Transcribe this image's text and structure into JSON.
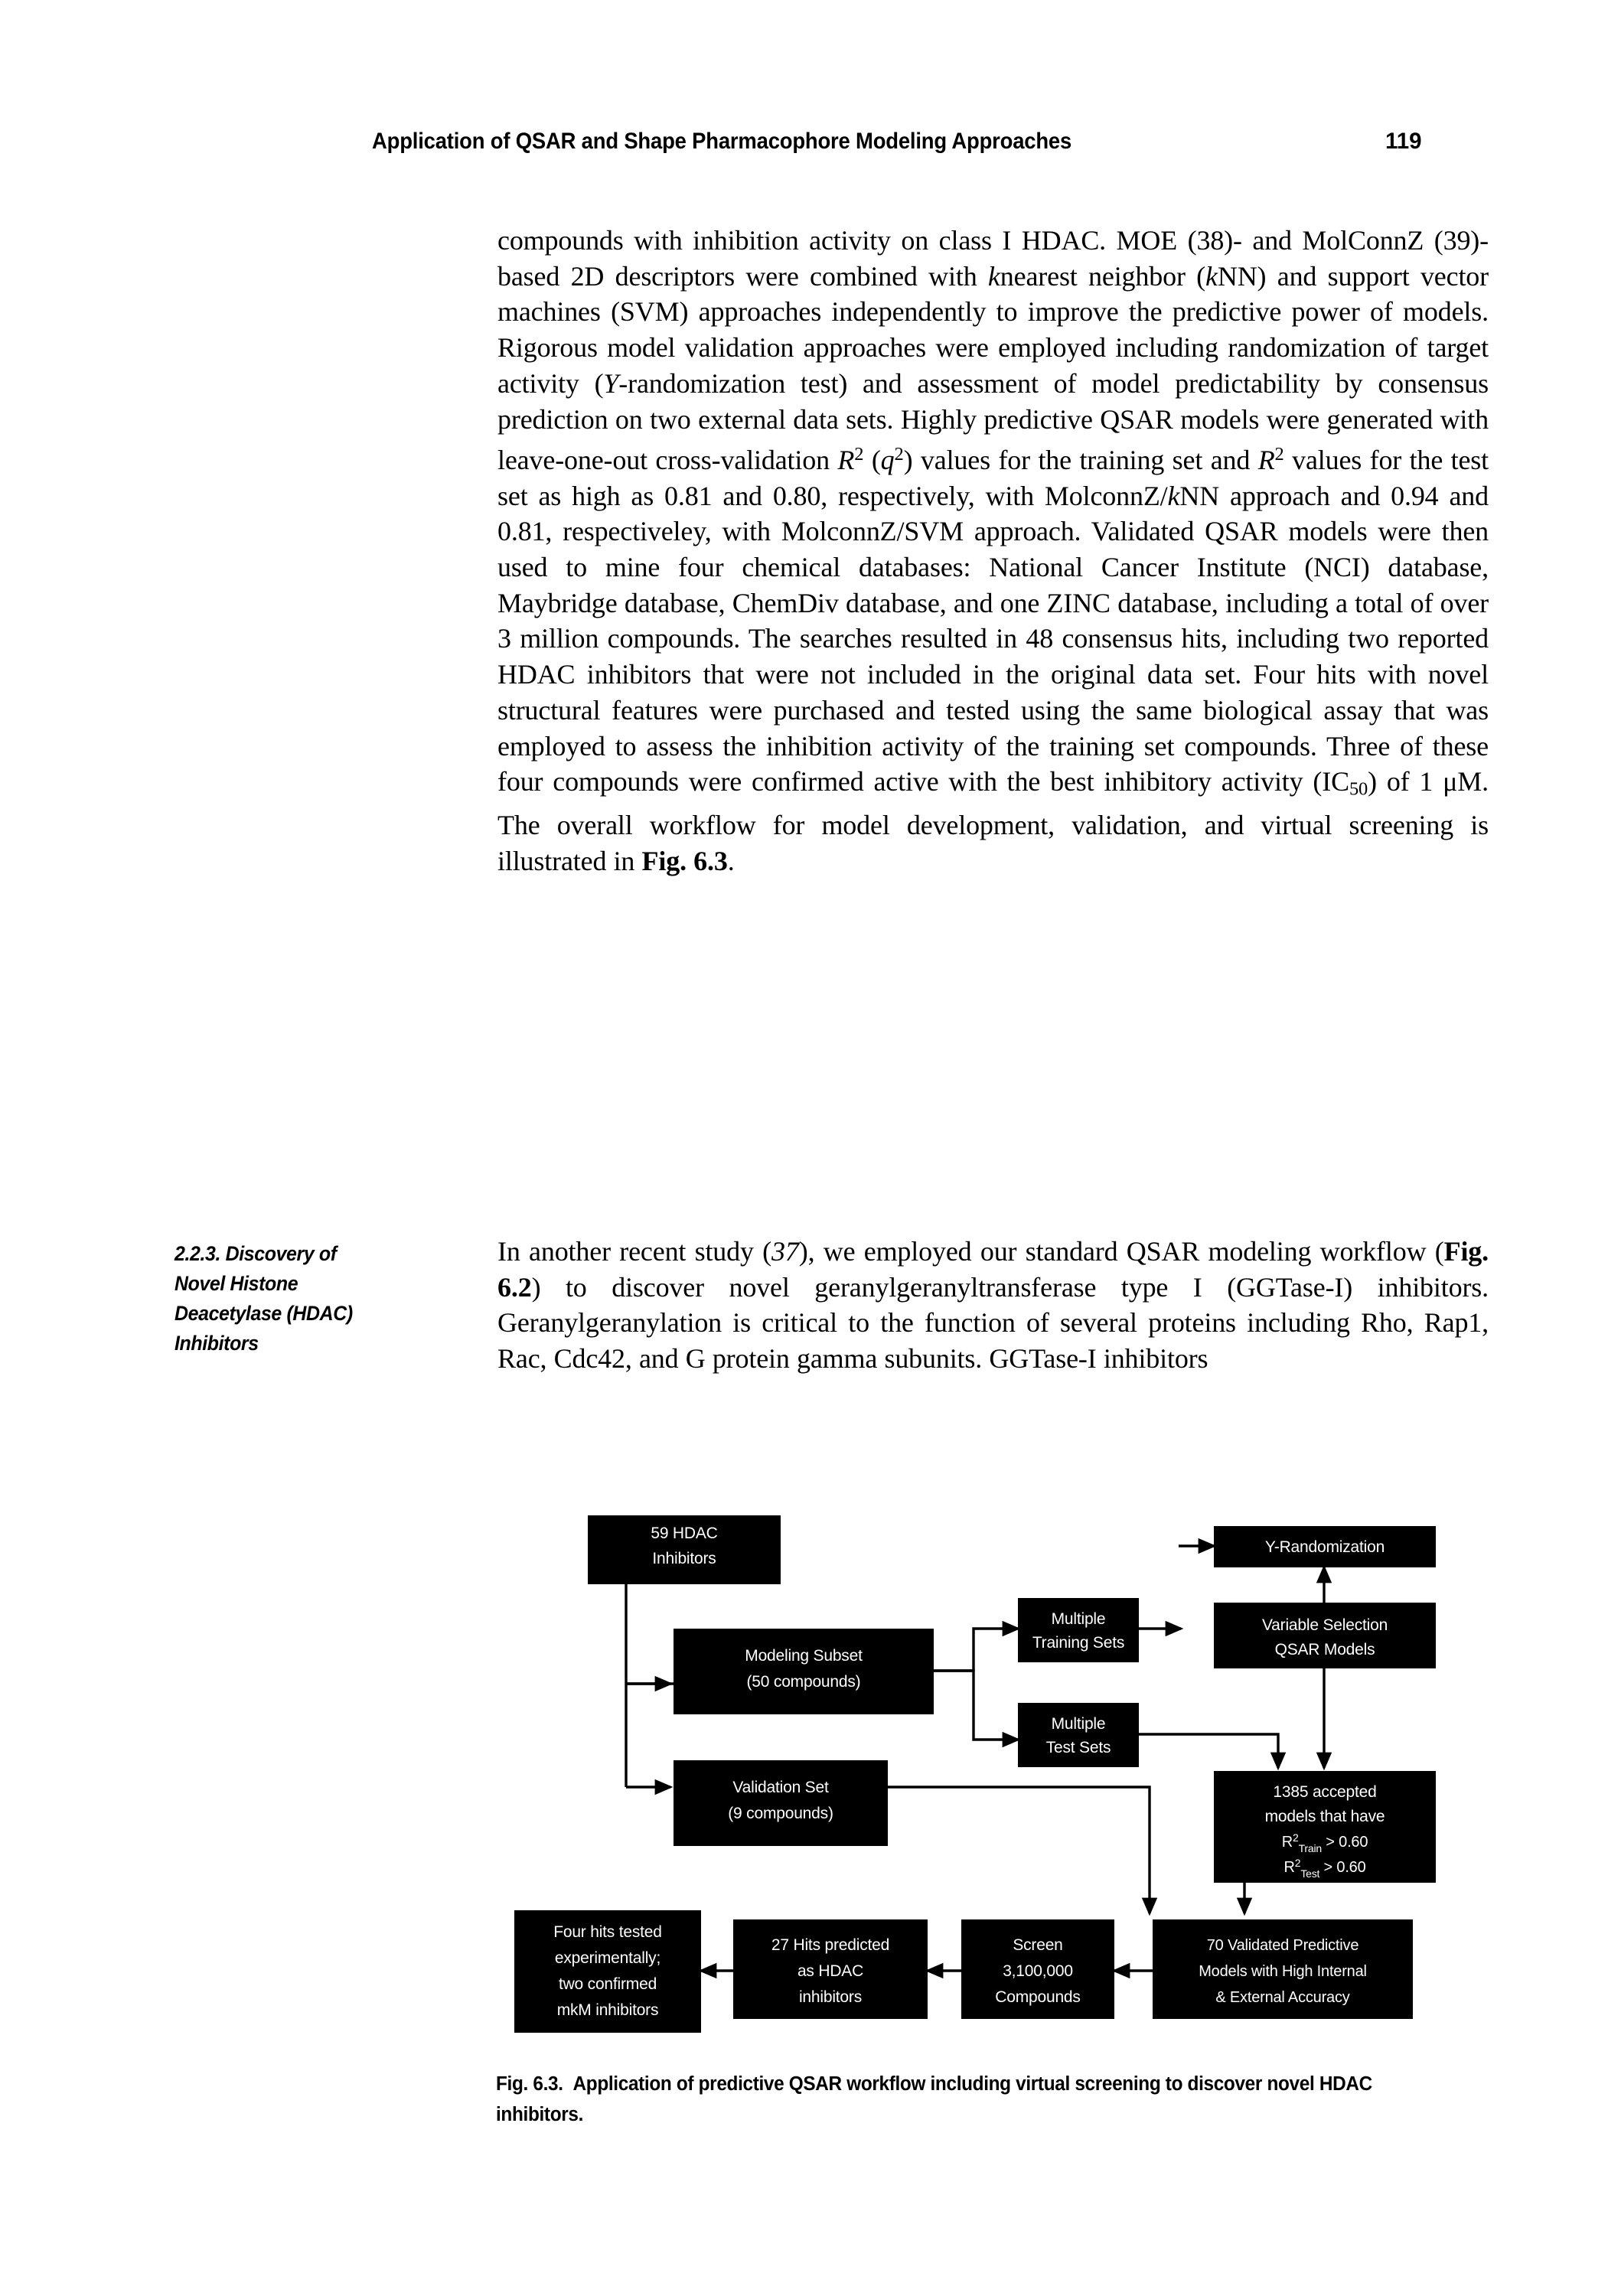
{
  "running_head": {
    "title": "Application of QSAR and Shape Pharmacophore Modeling Approaches",
    "page_number": "119"
  },
  "body": {
    "paragraph_1_parts": {
      "p1": "compounds with inhibition activity on class I HDAC. MOE (38)- and MolConnZ (39)-based 2D descriptors were combined with ",
      "k1": "k",
      "p2": "nearest neighbor (",
      "k2": "k",
      "p3": "NN) and support vector machines (SVM) approaches independently to improve the predictive power of models. Rigorous model validation approaches were employed including randomization of target activity (",
      "upsilon": "Υ",
      "p4": "-randomization test) and assessment of model predictability by consensus prediction on two external data sets. Highly predictive QSAR models were generated with leave-one-out cross-validation ",
      "r_1": "R",
      "sup_1": "2",
      "p5": " (",
      "q_1": "q",
      "sup_2": "2",
      "p6": ") values for the training set and ",
      "r_2": "R",
      "sup_3": "2",
      "p7": " values for the test set as high as 0.81 and 0.80, respectively, with MolconnZ/",
      "k3": "k",
      "p8": "NN approach and 0.94 and 0.81, respectiveley, with MolconnZ/SVM approach. Validated QSAR models were then used to mine four chemical databases: National Cancer Institute (NCI) database, Maybridge database, ChemDiv database, and one ZINC database, including a total of over 3 million compounds. The searches resulted in 48 consensus hits, including two reported HDAC inhibitors that were not included in the original data set. Four hits with novel structural features were purchased and tested using the same biological assay that was employed to assess the inhibition activity of the training set compounds. Three of these four compounds were confirmed active with the best inhibitory activity (IC",
      "sub_50": "50",
      "p9": ") of 1 μM. The overall workflow for model development, validation, and virtual screening is illustrated in ",
      "figref_1": "Fig. 6.3",
      "p10": "."
    },
    "paragraph_2_parts": {
      "p1": "In another recent study (",
      "ref37": "37",
      "p2": "), we employed our standard QSAR modeling workflow (",
      "figref_2": "Fig. 6.2",
      "p3": ") to discover novel geranylgeranyltransferase type I (GGTase-I) inhibitors. Geranylgeranylation is critical to the function of several proteins including Rho, Rap1, Rac, Cdc42, and G protein gamma subunits. GGTase-I inhibitors"
    }
  },
  "side_heading": {
    "line_1": "2.2.3. Discovery of",
    "line_2": "Novel Histone",
    "line_3": "Deacetylase (HDAC)",
    "line_4": "Inhibitors"
  },
  "figure": {
    "caption_label": "Fig. 6.3.",
    "caption_text": "Application of predictive QSAR workflow including virtual screening to discover novel HDAC inhibitors.",
    "box_fill": "#000000",
    "box_text_color": "#ffffff",
    "connector_color": "#000000",
    "nodes": [
      {
        "id": "hdac-inhibitors",
        "lines": [
          "59 HDAC",
          "Inhibitors"
        ]
      },
      {
        "id": "modeling-subset",
        "lines": [
          "Modeling Subset",
          "(50 compounds)"
        ]
      },
      {
        "id": "validation-set",
        "lines": [
          "Validation Set",
          "(9 compounds)"
        ]
      },
      {
        "id": "multiple-training-sets",
        "lines": [
          "Multiple",
          "Training Sets"
        ]
      },
      {
        "id": "multiple-test-sets",
        "lines": [
          "Multiple",
          "Test Sets"
        ]
      },
      {
        "id": "y-randomization",
        "lines": [
          "Y-Randomization"
        ]
      },
      {
        "id": "variable-selection",
        "lines": [
          "Variable Selection",
          "QSAR Models"
        ]
      },
      {
        "id": "accepted-models",
        "lines": [
          "1385 accepted",
          "models that have",
          "R2Train > 0.60",
          "R2Test > 0.60"
        ]
      },
      {
        "id": "validated-models",
        "lines": [
          "70 Validated Predictive",
          "Models with High Internal",
          "& External Accuracy"
        ]
      },
      {
        "id": "screen-compounds",
        "lines": [
          "Screen",
          "3,100,000",
          "Compounds"
        ]
      },
      {
        "id": "hits-predicted",
        "lines": [
          "27 Hits predicted",
          "as HDAC",
          "inhibitors"
        ]
      },
      {
        "id": "hits-tested",
        "lines": [
          "Four  hits tested",
          "experimentally;",
          "two confirmed",
          "mkM inhibitors"
        ]
      }
    ],
    "node_text": {
      "hdac_inhibitors_l1": "59 HDAC",
      "hdac_inhibitors_l2": "Inhibitors",
      "modeling_subset_l1": "Modeling Subset",
      "modeling_subset_l2": "(50 compounds)",
      "validation_set_l1": "Validation Set",
      "validation_set_l2": "(9 compounds)",
      "training_sets_l1": "Multiple",
      "training_sets_l2": "Training Sets",
      "test_sets_l1": "Multiple",
      "test_sets_l2": "Test Sets",
      "y_randomization": "Y-Randomization",
      "variable_selection_l1": "Variable Selection",
      "variable_selection_l2": "QSAR Models",
      "accepted_l1": "1385 accepted",
      "accepted_l2": "models that have",
      "accepted_r": "R",
      "accepted_sup": "2",
      "accepted_sub_train": "Train",
      "accepted_gt_train": " > 0.60",
      "accepted_sub_test": "Test",
      "accepted_gt_test": " > 0.60",
      "validated_l1": "70 Validated Predictive",
      "validated_l2": "Models with High Internal",
      "validated_l3": "& External Accuracy",
      "screen_l1": "Screen",
      "screen_l2": "3,100,000",
      "screen_l3": "Compounds",
      "predicted_l1": "27 Hits predicted",
      "predicted_l2": "as HDAC",
      "predicted_l3": "inhibitors",
      "tested_l1": "Four  hits tested",
      "tested_l2": "experimentally;",
      "tested_l3": "two confirmed",
      "tested_l4": "mkM inhibitors"
    }
  }
}
